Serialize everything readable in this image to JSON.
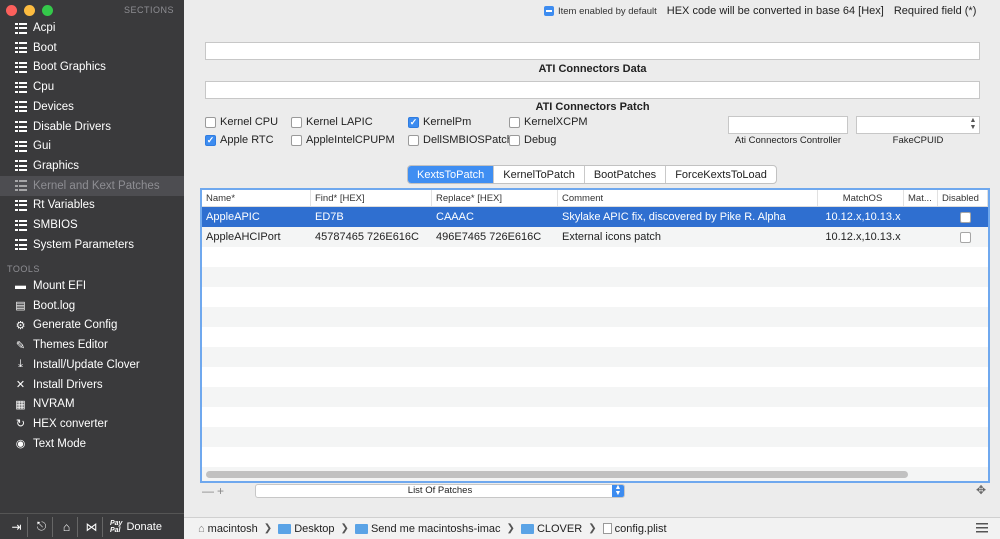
{
  "window": {
    "traffic_lights": {
      "close": "#fc605c",
      "minimize": "#fdbc40",
      "zoom": "#34c84a"
    }
  },
  "sidebar": {
    "sections_title": "SECTIONS",
    "sections": [
      {
        "label": "Acpi",
        "icon": "list-icon"
      },
      {
        "label": "Boot",
        "icon": "list-icon"
      },
      {
        "label": "Boot Graphics",
        "icon": "list-icon"
      },
      {
        "label": "Cpu",
        "icon": "list-icon"
      },
      {
        "label": "Devices",
        "icon": "list-icon"
      },
      {
        "label": "Disable Drivers",
        "icon": "list-icon"
      },
      {
        "label": "Gui",
        "icon": "list-icon"
      },
      {
        "label": "Graphics",
        "icon": "list-icon"
      },
      {
        "label": "Kernel and Kext Patches",
        "icon": "list-icon",
        "selected": true
      },
      {
        "label": "Rt Variables",
        "icon": "list-icon"
      },
      {
        "label": "SMBIOS",
        "icon": "list-icon"
      },
      {
        "label": "System Parameters",
        "icon": "list-icon"
      }
    ],
    "tools_title": "TOOLS",
    "tools": [
      {
        "label": "Mount EFI",
        "icon": "disk-icon"
      },
      {
        "label": "Boot.log",
        "icon": "document-icon"
      },
      {
        "label": "Generate Config",
        "icon": "gear-icon"
      },
      {
        "label": "Themes Editor",
        "icon": "brush-icon"
      },
      {
        "label": "Install/Update Clover",
        "icon": "download-icon"
      },
      {
        "label": "Install Drivers",
        "icon": "wrench-icon"
      },
      {
        "label": "NVRAM",
        "icon": "chip-icon"
      },
      {
        "label": "HEX converter",
        "icon": "refresh-icon"
      },
      {
        "label": "Text Mode",
        "icon": "eye-icon"
      }
    ],
    "bottom": {
      "paypal_line1": "Pay",
      "paypal_line2": "Pal",
      "donate_label": "Donate"
    }
  },
  "topbar": {
    "item_enabled_label": "Item enabled by default",
    "hex_note": "HEX code will be converted in base 64 [Hex]",
    "required_note": "Required field (*)"
  },
  "ati": {
    "connectors_data_value": "",
    "connectors_data_label": "ATI Connectors Data",
    "connectors_patch_value": "",
    "connectors_patch_label": "ATI Connectors Patch",
    "controller_value": "",
    "controller_label": "Ati Connectors Controller",
    "fakecpuid_value": "",
    "fakecpuid_label": "FakeCPUID"
  },
  "checkboxes": [
    {
      "label": "Kernel CPU",
      "checked": false
    },
    {
      "label": "Kernel LAPIC",
      "checked": false
    },
    {
      "label": "KernelPm",
      "checked": true
    },
    {
      "label": "KernelXCPM",
      "checked": false
    },
    {
      "label": "Apple RTC",
      "checked": true
    },
    {
      "label": "AppleIntelCPUPM",
      "checked": false
    },
    {
      "label": "DellSMBIOSPatch",
      "checked": false
    },
    {
      "label": "Debug",
      "checked": false
    }
  ],
  "tabs": [
    {
      "label": "KextsToPatch",
      "active": true
    },
    {
      "label": "KernelToPatch",
      "active": false
    },
    {
      "label": "BootPatches",
      "active": false
    },
    {
      "label": "ForceKextsToLoad",
      "active": false
    }
  ],
  "table": {
    "columns": [
      "Name*",
      "Find* [HEX]",
      "Replace* [HEX]",
      "Comment",
      "MatchOS",
      "Mat...",
      "Disabled"
    ],
    "rows": [
      {
        "name": "AppleAPIC",
        "find": "ED7B",
        "replace": "CAAAC",
        "comment": "Skylake APIC fix, discovered by Pike R. Alpha",
        "matchos": "10.12.x,10.13.x",
        "mat": "",
        "disabled": false,
        "selected": true
      },
      {
        "name": "AppleAHCIPort",
        "find": "45787465 726E616C",
        "replace": "496E7465 726E616C",
        "comment": "External icons patch",
        "matchos": "10.12.x,10.13.x",
        "mat": "",
        "disabled": false,
        "selected": false
      }
    ],
    "empty_rows": 13
  },
  "table_footer": {
    "add_remove": "—+",
    "list_select_value": "List Of Patches"
  },
  "pathbar": {
    "crumbs": [
      "macintosh",
      "Desktop",
      "Send me macintoshs-imac",
      "CLOVER",
      "config.plist"
    ]
  },
  "colors": {
    "sidebar_bg": "#3a3a3c",
    "accent": "#3d8cf0",
    "selected_row": "#2f6fd0"
  }
}
